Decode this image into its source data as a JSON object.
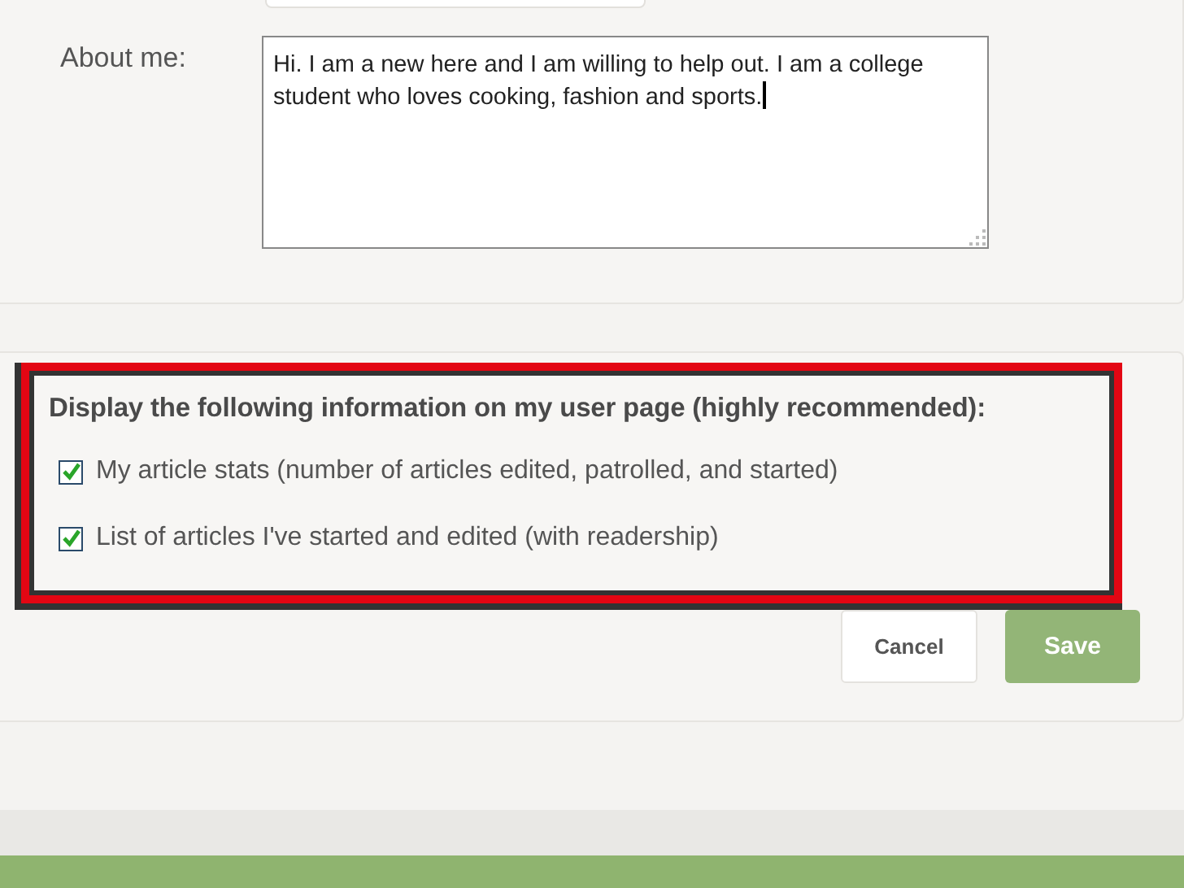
{
  "profile": {
    "about_label": "About me:",
    "about_value": "Hi. I am a new here and I am willing to help out. I am a college student who loves cooking, fashion and sports."
  },
  "display_options": {
    "heading": "Display the following information on my user page (highly recommended):",
    "options": [
      {
        "label": "My article stats (number of articles edited, patrolled, and started)",
        "checked": true
      },
      {
        "label": "List of articles I've started and edited (with readership)",
        "checked": true
      }
    ]
  },
  "buttons": [
    {
      "label": "Cancel",
      "kind": "secondary"
    },
    {
      "label": "Save",
      "kind": "primary"
    }
  ]
}
